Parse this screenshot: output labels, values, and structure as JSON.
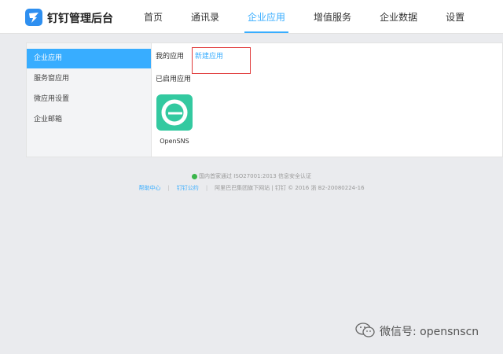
{
  "header": {
    "app_title": "钉钉管理后台",
    "nav": [
      {
        "label": "首页",
        "active": false
      },
      {
        "label": "通讯录",
        "active": false
      },
      {
        "label": "企业应用",
        "active": true
      },
      {
        "label": "增值服务",
        "active": false
      },
      {
        "label": "企业数据",
        "active": false
      },
      {
        "label": "设置",
        "active": false
      }
    ],
    "accent_color": "#38adff"
  },
  "sidebar": {
    "items": [
      {
        "label": "企业应用",
        "active": true
      },
      {
        "label": "服务窗应用",
        "active": false
      },
      {
        "label": "微应用设置",
        "active": false
      },
      {
        "label": "企业邮箱",
        "active": false
      }
    ]
  },
  "content": {
    "tabs": {
      "my_apps": "我的应用",
      "new_app": "新建应用"
    },
    "section_title": "已启用应用",
    "apps": [
      {
        "name": "OpenSNS",
        "icon": "opensns-logo-icon",
        "color": "#33c9a0"
      }
    ]
  },
  "footer": {
    "certification": "国内首家通过 ISO27001:2013 信息安全认证",
    "help_center": "帮助中心",
    "dingtalk_terms": "钉钉公约",
    "separator": "|",
    "copyright": "阿里巴巴集团旗下网站 | 钉钉 © 2016 浙 B2-20080224-16"
  },
  "watermark": {
    "text": "微信号: opensnscn",
    "icon": "wechat-icon"
  }
}
